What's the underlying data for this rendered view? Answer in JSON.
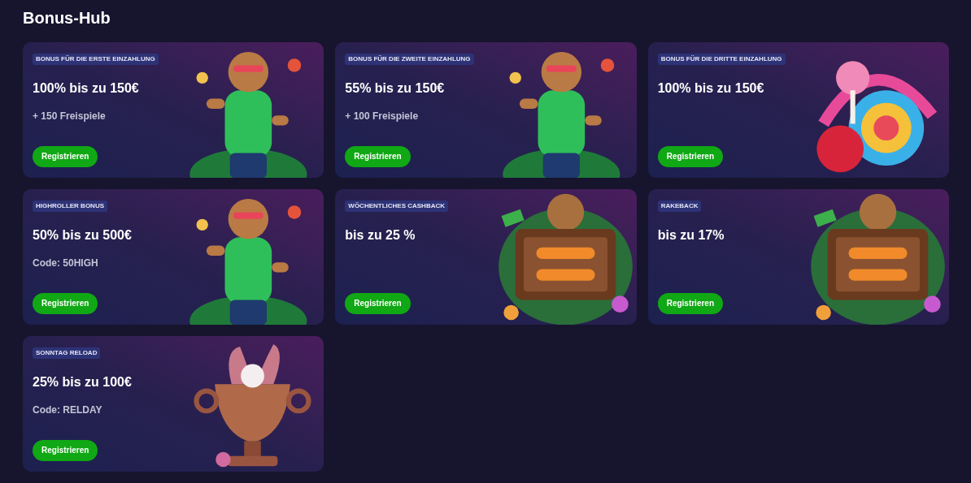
{
  "title": "Bonus-Hub",
  "cards": [
    {
      "tag": "BONUS FÜR DIE ERSTE EINZAHLUNG",
      "headline": "100% bis zu 150€",
      "subline": "+ 150 Freispiele",
      "button": "Registrieren"
    },
    {
      "tag": "BONUS FÜR DIE ZWEITE EINZAHLUNG",
      "headline": "55% bis zu 150€",
      "subline": "+ 100 Freispiele",
      "button": "Registrieren"
    },
    {
      "tag": "BONUS FÜR DIE DRITTE EINZAHLUNG",
      "headline": "100% bis zu 150€",
      "button": "Registrieren"
    },
    {
      "tag": "HIGHROLLER BONUS",
      "headline": "50% bis zu 500€",
      "subline": "Code: 50HIGH",
      "button": "Registrieren"
    },
    {
      "tag": "WÖCHENTLICHES CASHBACK",
      "headline": "bis zu 25 %",
      "button": "Registrieren",
      "kind": "picture"
    },
    {
      "tag": "RAKEBACK",
      "headline": "bis zu 17%",
      "button": "Registrieren",
      "kind": "picture"
    },
    {
      "tag": "SONNTAG RELOAD",
      "headline": "25% bis zu 100€",
      "subline": "Code: RELDAY",
      "button": "Registrieren"
    }
  ]
}
